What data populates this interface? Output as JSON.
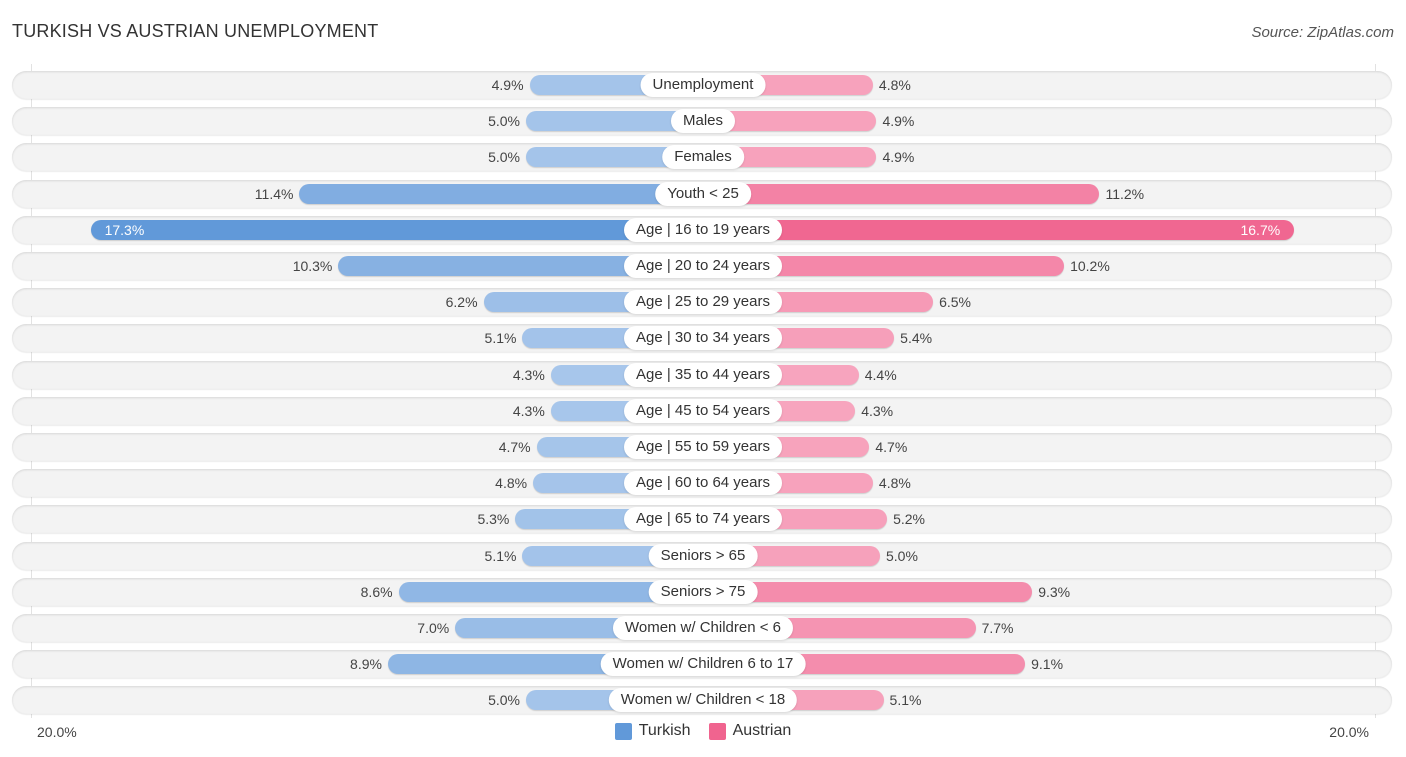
{
  "header": {
    "title": "TURKISH VS AUSTRIAN UNEMPLOYMENT",
    "source": "Source: ZipAtlas.com"
  },
  "colors": {
    "turkish_strong": "#6199d9",
    "turkish_light": "#a9c7eb",
    "austrian_strong": "#f0648f",
    "austrian_light": "#f7a6bf"
  },
  "chart_data": {
    "type": "bar",
    "orientation": "horizontal-diverging",
    "title": "TURKISH VS AUSTRIAN UNEMPLOYMENT",
    "unit": "%",
    "xlim": [
      -20,
      20
    ],
    "axis_labels": {
      "left": "20.0%",
      "right": "20.0%"
    },
    "legend": {
      "position": "bottom-center",
      "entries": [
        "Turkish",
        "Austrian"
      ]
    },
    "categories": [
      "Unemployment",
      "Males",
      "Females",
      "Youth < 25",
      "Age | 16 to 19 years",
      "Age | 20 to 24 years",
      "Age | 25 to 29 years",
      "Age | 30 to 34 years",
      "Age | 35 to 44 years",
      "Age | 45 to 54 years",
      "Age | 55 to 59 years",
      "Age | 60 to 64 years",
      "Age | 65 to 74 years",
      "Seniors > 65",
      "Seniors > 75",
      "Women w/ Children < 6",
      "Women w/ Children 6 to 17",
      "Women w/ Children < 18"
    ],
    "series": [
      {
        "name": "Turkish",
        "side": "left",
        "values": [
          4.9,
          5.0,
          5.0,
          11.4,
          17.3,
          10.3,
          6.2,
          5.1,
          4.3,
          4.3,
          4.7,
          4.8,
          5.3,
          5.1,
          8.6,
          7.0,
          8.9,
          5.0
        ],
        "labels": [
          "4.9%",
          "5.0%",
          "5.0%",
          "11.4%",
          "17.3%",
          "10.3%",
          "6.2%",
          "5.1%",
          "4.3%",
          "4.3%",
          "4.7%",
          "4.8%",
          "5.3%",
          "5.1%",
          "8.6%",
          "7.0%",
          "8.9%",
          "5.0%"
        ]
      },
      {
        "name": "Austrian",
        "side": "right",
        "values": [
          4.8,
          4.9,
          4.9,
          11.2,
          16.7,
          10.2,
          6.5,
          5.4,
          4.4,
          4.3,
          4.7,
          4.8,
          5.2,
          5.0,
          9.3,
          7.7,
          9.1,
          5.1
        ],
        "labels": [
          "4.8%",
          "4.9%",
          "4.9%",
          "11.2%",
          "16.7%",
          "10.2%",
          "6.5%",
          "5.4%",
          "4.4%",
          "4.3%",
          "4.7%",
          "4.8%",
          "5.2%",
          "5.0%",
          "9.3%",
          "7.7%",
          "9.1%",
          "5.1%"
        ]
      }
    ]
  }
}
